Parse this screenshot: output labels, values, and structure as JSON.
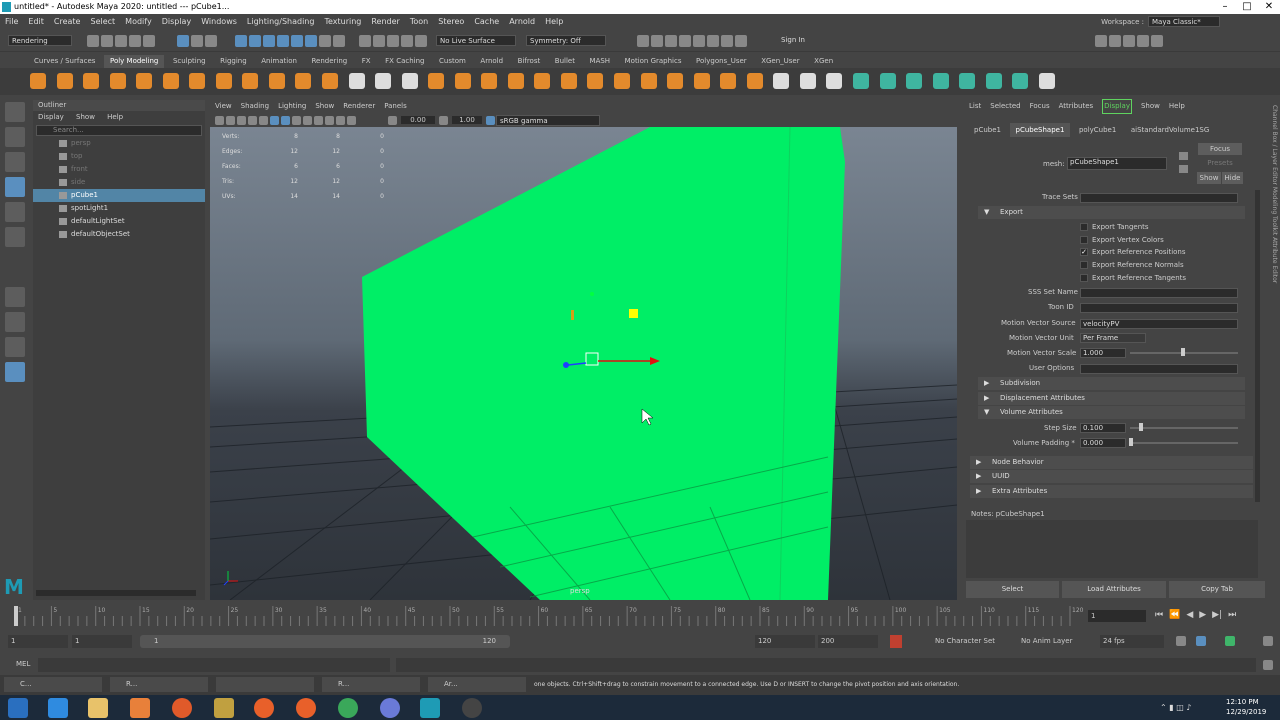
{
  "title_bar": {
    "title": "untitled* - Autodesk Maya 2020: untitled   ---   pCube1..."
  },
  "menu": [
    "File",
    "Edit",
    "Create",
    "Select",
    "Modify",
    "Display",
    "Windows",
    "Lighting/Shading",
    "Texturing",
    "Render",
    "Toon",
    "Stereo",
    "Cache",
    "Arnold",
    "Help"
  ],
  "workspace": {
    "label": "Workspace :",
    "value": "Maya Classic*"
  },
  "status": {
    "menuset": "Rendering",
    "live_surface": "No Live Surface",
    "symmetry": "Symmetry: Off",
    "sign_in": "Sign In"
  },
  "shelf_tabs": [
    "Curves / Surfaces",
    "Poly Modeling",
    "Sculpting",
    "Rigging",
    "Animation",
    "Rendering",
    "FX",
    "FX Caching",
    "Custom",
    "Arnold",
    "Bifrost",
    "Bullet",
    "MASH",
    "Motion Graphics",
    "Polygons_User",
    "XGen_User",
    "XGen"
  ],
  "outliner": {
    "title": "Outliner",
    "menu": [
      "Display",
      "Show",
      "Help"
    ],
    "search_placeholder": "Search...",
    "items": [
      {
        "label": "persp"
      },
      {
        "label": "top"
      },
      {
        "label": "front"
      },
      {
        "label": "side"
      },
      {
        "label": "pCube1"
      },
      {
        "label": "spotLight1"
      },
      {
        "label": "defaultLightSet"
      },
      {
        "label": "defaultObjectSet"
      }
    ]
  },
  "viewport": {
    "menu": [
      "View",
      "Shading",
      "Lighting",
      "Show",
      "Renderer",
      "Panels"
    ],
    "exposure": "0.00",
    "gamma": "1.00",
    "colorspace": "sRGB gamma",
    "camera_label": "persp",
    "hud": [
      [
        "Verts:",
        "8",
        "8",
        "0"
      ],
      [
        "Edges:",
        "12",
        "12",
        "0"
      ],
      [
        "Faces:",
        "6",
        "6",
        "0"
      ],
      [
        "Tris:",
        "12",
        "12",
        "0"
      ],
      [
        "UVs:",
        "14",
        "14",
        "0"
      ]
    ]
  },
  "attribute_editor": {
    "menu": [
      "List",
      "Selected",
      "Focus",
      "Attributes",
      "Display",
      "Show",
      "Help"
    ],
    "tabs": [
      "pCube1",
      "pCubeShape1",
      "polyCube1",
      "aiStandardVolume1SG"
    ],
    "mesh_label": "mesh:",
    "mesh_value": "pCubeShape1",
    "focus": "Focus",
    "presets": "Presets",
    "show": "Show",
    "hide": "Hide",
    "trace_sets": "Trace Sets",
    "export_section": "Export",
    "export_options": [
      {
        "label": "Export Tangents",
        "checked": false
      },
      {
        "label": "Export Vertex Colors",
        "checked": false
      },
      {
        "label": "Export Reference Positions",
        "checked": true
      },
      {
        "label": "Export Reference Normals",
        "checked": false
      },
      {
        "label": "Export Reference Tangents",
        "checked": false
      }
    ],
    "check_mark": "✓",
    "sss_set_name": "SSS Set Name",
    "toon_id": "Toon ID",
    "motion_vector_source": "Motion Vector Source",
    "motion_vector_source_value": "velocityPV",
    "motion_vector_unit": "Motion Vector Unit",
    "motion_vector_unit_value": "Per Frame",
    "motion_vector_scale": "Motion Vector Scale",
    "motion_vector_scale_value": "1.000",
    "user_options": "User Options",
    "subdivision": "Subdivision",
    "displacement": "Displacement Attributes",
    "volume": "Volume Attributes",
    "step_size": "Step Size",
    "step_size_value": "0.100",
    "volume_padding": "Volume Padding *",
    "volume_padding_value": "0.000",
    "node_behavior": "Node Behavior",
    "uuid": "UUID",
    "extra": "Extra Attributes",
    "notes": "Notes:  pCubeShape1",
    "buttons": [
      "Select",
      "Load Attributes",
      "Copy Tab"
    ],
    "side_tabs": "Channel Box / Layer Editor   Modeling Toolkit   Attribute Editor"
  },
  "timeline": {
    "ticks": [
      "1",
      "5",
      "10",
      "15",
      "20",
      "25",
      "30",
      "35",
      "40",
      "45",
      "50",
      "55",
      "60",
      "65",
      "70",
      "75",
      "80",
      "85",
      "90",
      "95",
      "100",
      "105",
      "110",
      "115",
      "120"
    ],
    "current_frame": "1",
    "range_start": "1",
    "range_inner_start": "1",
    "slider_start": "1",
    "slider_end": "120",
    "range_end": "120",
    "anim_end": "200",
    "character_set": "No Character Set",
    "anim_layer": "No Anim Layer",
    "fps": "24 fps"
  },
  "mel": {
    "label": "MEL",
    "help_text": "one objects. Ctrl+Shift+drag to constrain movement to a connected edge. Use D or INSERT to change the pivot position and axis orientation."
  },
  "task_strip": [
    "C...",
    "R...",
    "R...",
    "Ar..."
  ],
  "taskbar": {
    "time": "12:10 PM",
    "date": "12/29/2019"
  },
  "colors": {
    "cube": "#00ee66",
    "selection": "#5285a6",
    "accent": "#5a8fbf"
  }
}
